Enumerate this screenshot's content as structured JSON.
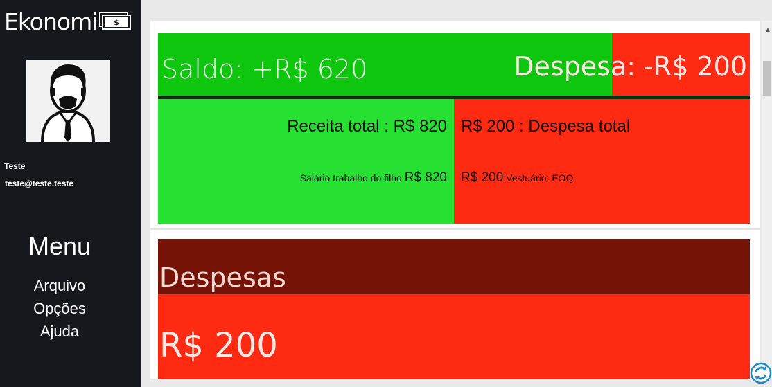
{
  "app": {
    "title": "Ekonomi"
  },
  "user": {
    "name": "Teste",
    "email": "teste@teste.teste"
  },
  "menu": {
    "title": "Menu",
    "items": [
      {
        "label": "Arquivo"
      },
      {
        "label": "Opções"
      },
      {
        "label": "Ajuda"
      }
    ]
  },
  "summary": {
    "saldo": "Saldo: +R$ 620",
    "despesa": "Despesa: -R$ 200",
    "receita_title": "Receita total : R$ 820",
    "despesa_title": "R$ 200 : Despesa total",
    "receita_item_label": "Salário trabalho do filho",
    "receita_item_value": "R$ 820",
    "despesa_item_value": "R$ 200",
    "despesa_item_label": "Vestuário: EOQ"
  },
  "despesas_card": {
    "title": "Despesas",
    "value": "R$ 200"
  },
  "colors": {
    "sidebar": "#15191d",
    "saldo_green": "#0fc60f",
    "receita_green": "#26e032",
    "despesa_red": "#ff2a12",
    "despesas_header": "#751307"
  },
  "icons": [
    "money-icon",
    "avatar-icon",
    "minimize-icon",
    "close-icon",
    "refresh-icon"
  ]
}
